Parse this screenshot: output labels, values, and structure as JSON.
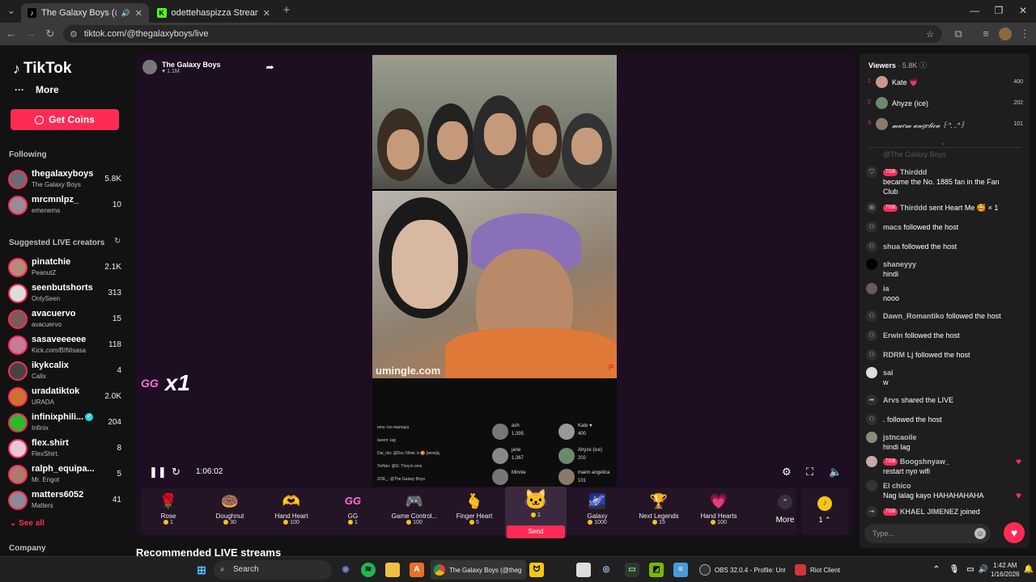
{
  "browser": {
    "tabs": [
      {
        "title": "The Galaxy Boys (@thegala",
        "favicon": "tiktok-icon",
        "active": true
      },
      {
        "title": "odettehaspizza Stream - Watch",
        "favicon": "kick-icon",
        "active": false
      }
    ],
    "url": "tiktok.com/@thegalaxyboys/live"
  },
  "sidebar": {
    "logo": "TikTok",
    "more_label": "More",
    "get_coins_label": "Get Coins",
    "following_heading": "Following",
    "following": [
      {
        "name": "thegalaxyboys",
        "sub": "The Galaxy Boys",
        "count": "5.8K"
      },
      {
        "name": "mrcmnlpz_",
        "sub": "emenems",
        "count": "10"
      }
    ],
    "suggested_heading": "Suggested LIVE creators",
    "suggested": [
      {
        "name": "pinatchie",
        "sub": "PeanutZ",
        "count": "2.1K"
      },
      {
        "name": "seenbutshorts",
        "sub": "OnlySeen",
        "count": "313"
      },
      {
        "name": "avacuervo",
        "sub": "avacuervo",
        "count": "15"
      },
      {
        "name": "sasaveeeeee",
        "sub": "Kick.com/BINIsasa",
        "count": "118"
      },
      {
        "name": "ikykcalix",
        "sub": "Calix",
        "count": "4"
      },
      {
        "name": "uradatiktok",
        "sub": "URADA",
        "count": "2.0K"
      },
      {
        "name": "infinixphili...",
        "sub": "Infinix",
        "count": "204"
      },
      {
        "name": "flex.shirt",
        "sub": "FlexShirt.",
        "count": "8"
      },
      {
        "name": "ralph_equipa...",
        "sub": "Mr. Engot",
        "count": "5"
      },
      {
        "name": "matters6052",
        "sub": "Matters",
        "count": "41"
      }
    ],
    "see_all": "See all",
    "company": "Company"
  },
  "stream": {
    "host_name": "The Galaxy Boys",
    "host_likes": "1.1M",
    "watermark": "umingle.com",
    "combo_gift": "GG",
    "combo_count": "x1",
    "elapsed": "1:06:02",
    "inner_chat": [
      "ems: lso mamaya",
      "lavem: lag",
      "Dai_rits: @Doc Nhiel. b 🤩 [wow]q.",
      "YoHan: @G: Thej.m oms",
      "ZOE_: @The Galaxy Boys"
    ],
    "inner_leaders": [
      {
        "name": "ash",
        "score": "1,395"
      },
      {
        "name": "jane",
        "score": "1,367"
      },
      {
        "name": "Minnie",
        "score": ""
      },
      {
        "name": "Kate ♥",
        "score": "400"
      },
      {
        "name": "Ahyze (ice)",
        "score": "202"
      },
      {
        "name": "mæm angelica",
        "score": "101"
      }
    ]
  },
  "gifts": [
    {
      "name": "Rose",
      "price": "1",
      "icon": "🌹"
    },
    {
      "name": "Doughnut",
      "price": "30",
      "icon": "🍩"
    },
    {
      "name": "Hand Heart",
      "price": "100",
      "icon": "🫶"
    },
    {
      "name": "GG",
      "price": "1",
      "icon": "GG"
    },
    {
      "name": "Game Control...",
      "price": "100",
      "icon": "🎮"
    },
    {
      "name": "Finger Heart",
      "price": "5",
      "icon": "🫰"
    },
    {
      "name": "",
      "price": "1",
      "icon": "🐱",
      "selected": true,
      "send_label": "Send"
    },
    {
      "name": "Galaxy",
      "price": "1000",
      "icon": "🌌"
    },
    {
      "name": "Next Legends",
      "price": "15",
      "icon": "🏆"
    },
    {
      "name": "Hand Hearts",
      "price": "100",
      "icon": "💗"
    }
  ],
  "gift_more_label": "More",
  "coin_balance": "1",
  "recommended_heading": "Recommended LIVE streams",
  "viewers": {
    "heading": "Viewers",
    "count": "· 5.8K",
    "top": [
      {
        "rank": "1",
        "name": "Kate 💗",
        "score": "400"
      },
      {
        "rank": "2",
        "name": "Ahyze (ice)",
        "score": "202"
      },
      {
        "rank": "3",
        "name": "𝓂𝒶𝑒𝓂 𝒶𝓃𝑔𝑒𝓁𝒾𝒸𝒶 ꒰ᐢ. .ᐢ꒱",
        "score": "101"
      }
    ]
  },
  "chat": {
    "faded": "@The Galaxy Boys",
    "messages": [
      {
        "icon": "shield-icon",
        "badge": "TGB",
        "user": "Thirddd",
        "text": "became the No. 1885 fan in the Fan Club"
      },
      {
        "icon": "gift-icon",
        "badge": "TGB",
        "user": "Thirddd",
        "text": "sent Heart Me 🥰 × 1"
      },
      {
        "icon": "follow-icon",
        "user": "macs",
        "text": "followed the host"
      },
      {
        "icon": "follow-icon",
        "user": "shua",
        "text": "followed the host"
      },
      {
        "icon": "avatar",
        "user": "shaneyyy",
        "text": "hindi"
      },
      {
        "icon": "avatar",
        "user": "ia",
        "text": "nooo"
      },
      {
        "icon": "follow-icon",
        "user": "Dawn_Romantiko",
        "text": "followed the host"
      },
      {
        "icon": "follow-icon",
        "user": "Erwin",
        "text": "followed the host"
      },
      {
        "icon": "follow-icon",
        "user": "RDRM Lj",
        "text": "followed the host"
      },
      {
        "icon": "avatar",
        "user": "sai",
        "text": "w"
      },
      {
        "icon": "share-icon",
        "user": "Arvs",
        "text": "shared the LIVE"
      },
      {
        "icon": "follow-icon",
        "user": ".",
        "text": "followed the host"
      },
      {
        "icon": "avatar",
        "user": "jstncaoile",
        "text": "hindi lag"
      },
      {
        "icon": "avatar",
        "badge": "TGB",
        "user": "Boogshnyaw_",
        "text": "restart nyo wifi"
      },
      {
        "icon": "avatar",
        "user": "El chico",
        "text": "Nag lalag kayo HAHAHAHAHA"
      },
      {
        "icon": "join-icon",
        "badge": "TGB",
        "user": "KHAEL JIMENEZ",
        "text": "joined"
      }
    ],
    "input_placeholder": "Type..."
  },
  "taskbar": {
    "search_label": "Search",
    "apps": [
      {
        "label": "The Galaxy Boys (@theg",
        "active": true
      },
      {
        "label": "OBS 32.0.4 - Profile: Unt",
        "active": false
      },
      {
        "label": "Riot Client",
        "active": false
      }
    ],
    "time": "1:42 AM",
    "date": "1/16/2026"
  },
  "colors": {
    "accent": "#fe2c55",
    "coin": "#f5c518",
    "stream_bg": "#1e0e22",
    "panel_bg": "#1e1e1e"
  }
}
